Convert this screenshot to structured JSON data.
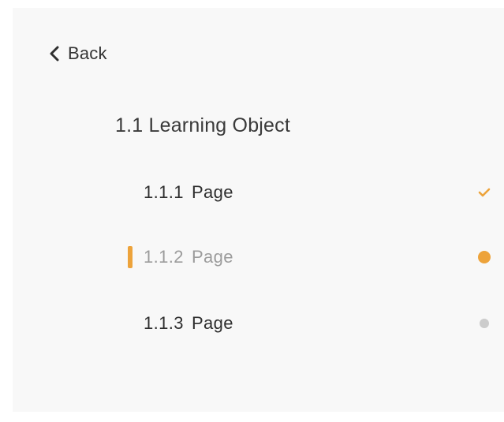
{
  "nav": {
    "back_label": "Back",
    "section_title": "1.1 Learning Object",
    "items": [
      {
        "number": "1.1.1",
        "label": "Page",
        "status": "completed"
      },
      {
        "number": "1.1.2",
        "label": "Page",
        "status": "in-progress",
        "current": true
      },
      {
        "number": "1.1.3",
        "label": "Page",
        "status": "not-started"
      }
    ]
  },
  "colors": {
    "accent": "#eda33b",
    "pending": "#cccccc",
    "panel_bg": "#f8f8f8"
  },
  "icons": {
    "back": "chevron-left-icon",
    "completed": "checkmark-icon",
    "in_progress": "orange-dot-icon",
    "not_started": "grey-dot-icon"
  }
}
